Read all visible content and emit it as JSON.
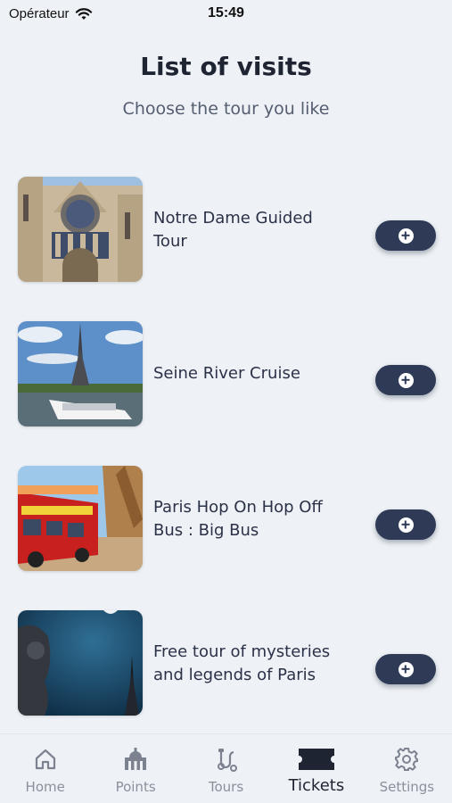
{
  "status_bar": {
    "carrier": "Opérateur",
    "time": "15:49"
  },
  "header": {
    "title": "List of visits",
    "subtitle": "Choose the tour you like"
  },
  "visits": [
    {
      "title": "Notre Dame Guided Tour",
      "image": "notre-dame-cathedral"
    },
    {
      "title": "Seine River Cruise",
      "image": "eiffel-tower-river-boat"
    },
    {
      "title": "Paris Hop On Hop Off Bus : Big Bus",
      "image": "red-double-decker-bus"
    },
    {
      "title": "Free tour of mysteries and legends of Paris",
      "image": "gargoyle-night-eiffel"
    }
  ],
  "tabs": [
    {
      "label": "Home",
      "icon": "home-icon",
      "active": false
    },
    {
      "label": "Points",
      "icon": "monument-icon",
      "active": false
    },
    {
      "label": "Tours",
      "icon": "route-icon",
      "active": false
    },
    {
      "label": "Tickets",
      "icon": "ticket-icon",
      "active": true
    },
    {
      "label": "Settings",
      "icon": "gear-icon",
      "active": false
    }
  ],
  "colors": {
    "accent": "#2e3a56",
    "background": "#eef2f6",
    "inactive_tab": "#8a8f9c"
  }
}
